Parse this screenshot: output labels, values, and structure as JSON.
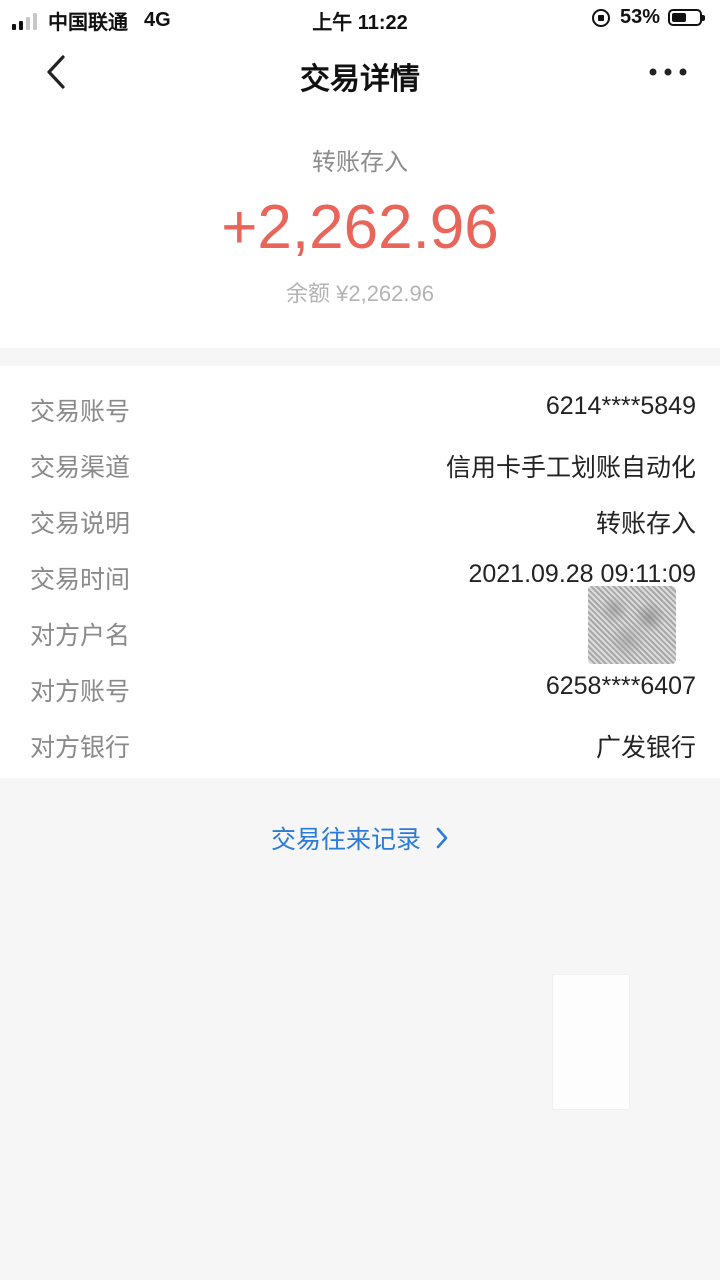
{
  "status_bar": {
    "carrier": "中国联通",
    "network": "4G",
    "time": "上午 11:22",
    "battery_percent_label": "53%",
    "battery_level": 0.53,
    "signal_bars_active": 2,
    "signal_bars_total": 4,
    "icons": [
      "signal-icon",
      "orientation-lock-icon",
      "battery-icon"
    ]
  },
  "nav": {
    "title": "交易详情",
    "back_icon": "chevron-left-icon",
    "more_icon": "more-horizontal-icon"
  },
  "summary": {
    "type": "转账存入",
    "amount": "+2,262.96",
    "balance": "余额 ¥2,262.96"
  },
  "details": [
    {
      "label": "交易账号",
      "value": "6214****5849"
    },
    {
      "label": "交易渠道",
      "value": "信用卡手工划账自动化"
    },
    {
      "label": "交易说明",
      "value": "转账存入"
    },
    {
      "label": "交易时间",
      "value": "2021.09.28 09:11:09"
    },
    {
      "label": "对方户名",
      "value": ""
    },
    {
      "label": "对方账号",
      "value": "6258****6407"
    },
    {
      "label": "对方银行",
      "value": "广发银行"
    }
  ],
  "history_link": {
    "label": "交易往来记录",
    "icon": "chevron-right-icon"
  },
  "colors": {
    "amount": "#e9655a",
    "link": "#2b7bd9",
    "label": "#8a8a8a",
    "background": "#f6f6f6"
  }
}
